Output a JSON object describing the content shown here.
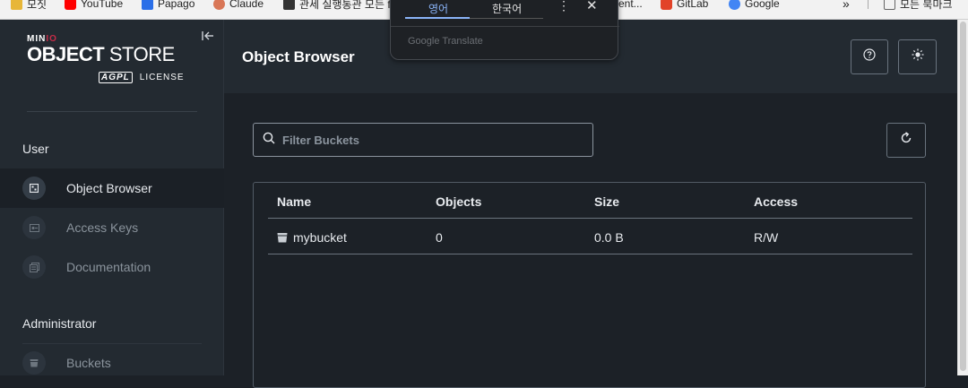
{
  "bookmarks": [
    {
      "label": "모짓",
      "color": "#e7b638"
    },
    {
      "label": "YouTube",
      "color": "#ff0000"
    },
    {
      "label": "Papago",
      "color": "#2b6fe8"
    },
    {
      "label": "Claude",
      "color": "#d97757"
    },
    {
      "label": "관세 실행통관 모든 f",
      "color": "#333333"
    },
    {
      "label": "ent...",
      "color": ""
    },
    {
      "label": "GitLab",
      "color": "#e24329"
    },
    {
      "label": "Google",
      "color": "#4285f4"
    },
    {
      "label": "모든 북마크",
      "color": "#888888"
    }
  ],
  "logo": {
    "brand_prefix": "MIN",
    "brand_accent": "IO",
    "product_bold": "OBJECT",
    "product_light": " STORE",
    "license_badge": "AGPL",
    "license_text": "LICENSE"
  },
  "sidebar": {
    "section_user": "User",
    "items_user": [
      {
        "label": "Object Browser",
        "icon": "bucket-grid-icon",
        "active": true
      },
      {
        "label": "Access Keys",
        "icon": "key-icon",
        "active": false
      },
      {
        "label": "Documentation",
        "icon": "docs-icon",
        "active": false
      }
    ],
    "section_admin": "Administrator",
    "items_admin": [
      {
        "label": "Buckets",
        "icon": "bucket-icon",
        "active": false
      }
    ]
  },
  "header": {
    "title": "Object Browser"
  },
  "filter": {
    "placeholder": "Filter Buckets"
  },
  "table": {
    "columns": [
      "Name",
      "Objects",
      "Size",
      "Access"
    ],
    "rows": [
      {
        "name": "mybucket",
        "objects": "0",
        "size": "0.0 B",
        "access": "R/W"
      }
    ]
  },
  "translate_popup": {
    "tab_source": "영어",
    "tab_target": "한국어",
    "brand": "Google Translate"
  },
  "colors": {
    "accent": "#c72c48",
    "bg_main": "#1c2127",
    "bg_sidebar": "#232a31",
    "translate_accent": "#8ab4f8"
  }
}
